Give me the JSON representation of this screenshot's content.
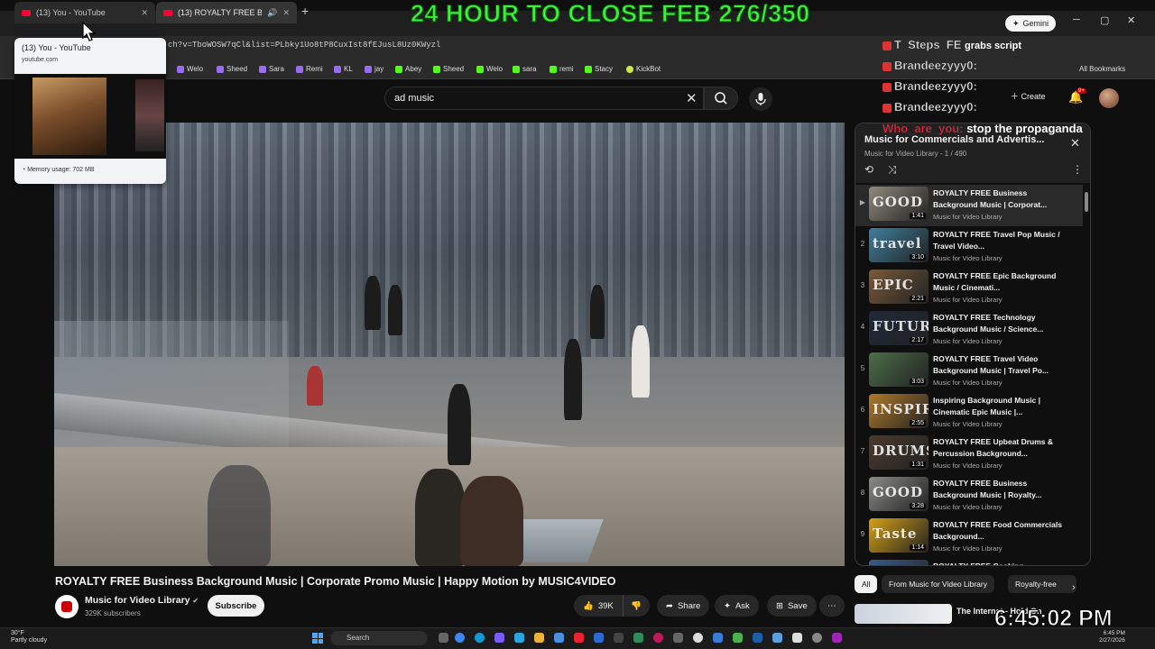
{
  "overlay": {
    "title": "24 HOUR TO CLOSE FEB 276/350",
    "clock": "6:45:02 PM",
    "chat": [
      {
        "user": "T_Steps_FE",
        "message": "grabs script"
      },
      {
        "user": "Brandeezyyy0:",
        "message": ""
      },
      {
        "user": "Brandeezyyy0:",
        "message": ""
      },
      {
        "user": "Brandeezyyy0:",
        "message": ""
      },
      {
        "user": "Who_are_you:",
        "message": "stop the propaganda"
      }
    ]
  },
  "browser": {
    "tabs": [
      {
        "title": "(13) You - YouTube"
      },
      {
        "title": "(13) ROYALTY FREE Business"
      }
    ],
    "new_tab": "+",
    "gemini_label": "Gemini",
    "url": "ch?v=TboWOSW7qCl&list=PLbky1Uo8tP8CuxIst8fEJusL8Uz0KWyzl",
    "bookmarks": [
      "Welo",
      "Sheed",
      "Sara",
      "Remi",
      "KL",
      "jay",
      "Abey",
      "Sheed",
      "Welo",
      "sara",
      "remi",
      "Stacy",
      "KickBot"
    ],
    "all_bookmarks": "All Bookmarks",
    "hover_card": {
      "title": "(13) You - YouTube",
      "domain": "youtube.com",
      "memory": "Memory usage: 702 MB"
    }
  },
  "youtube": {
    "search_value": "ad music",
    "create_label": "Create",
    "notif_count": "9+",
    "video": {
      "title": "ROYALTY FREE Business Background Music | Corporate Promo Music | Happy Motion by MUSIC4VIDEO",
      "channel": "Music for Video Library",
      "subscribers": "329K subscribers",
      "subscribe_label": "Subscribe",
      "likes": "39K",
      "share_label": "Share",
      "ask_label": "Ask",
      "save_label": "Save"
    },
    "playlist": {
      "title": "Music for Commercials and Advertis...",
      "subtitle": "Music for Video Library - 1 / 490",
      "items": [
        {
          "index": "",
          "thumb_word": "GOOD",
          "duration": "1:41",
          "title": "ROYALTY FREE Business Background Music | Corporat...",
          "channel": "Music for Video Library",
          "color": "#8f8a7c"
        },
        {
          "index": "2",
          "thumb_word": "travel",
          "duration": "3:10",
          "title": "ROYALTY FREE Travel Pop Music / Travel Video...",
          "channel": "Music for Video Library",
          "color": "#3f7f9c"
        },
        {
          "index": "3",
          "thumb_word": "EPIC",
          "duration": "2:21",
          "title": "ROYALTY FREE Epic Background Music / Cinemati...",
          "channel": "Music for Video Library",
          "color": "#7a5a3a"
        },
        {
          "index": "4",
          "thumb_word": "FUTURE",
          "duration": "2:17",
          "title": "ROYALTY FREE Technology Background Music / Science...",
          "channel": "Music for Video Library",
          "color": "#1e2a3a"
        },
        {
          "index": "5",
          "thumb_word": "",
          "duration": "3:03",
          "title": "ROYALTY FREE Travel Video Background Music | Travel Po...",
          "channel": "Music for Video Library",
          "color": "#4d6e4a"
        },
        {
          "index": "6",
          "thumb_word": "INSPIR",
          "duration": "2:55",
          "title": "Inspiring Background Music | Cinematic Epic Music |...",
          "channel": "Music for Video Library",
          "color": "#b07a2a"
        },
        {
          "index": "7",
          "thumb_word": "DRUMS",
          "duration": "1:31",
          "title": "ROYALTY FREE Upbeat Drums & Percussion Background...",
          "channel": "Music for Video Library",
          "color": "#4a3a2e"
        },
        {
          "index": "8",
          "thumb_word": "GOOD",
          "duration": "3:28",
          "title": "ROYALTY FREE Business Background Music | Royalty...",
          "channel": "Music for Video Library",
          "color": "#8a8a88"
        },
        {
          "index": "9",
          "thumb_word": "Taste",
          "duration": "1:14",
          "title": "ROYALTY FREE Food Commercials Background...",
          "channel": "Music for Video Library",
          "color": "#d4a017"
        },
        {
          "index": "",
          "thumb_word": "",
          "duration": "",
          "title": "ROYALTY FREE Cooking",
          "channel": "",
          "color": "#3a5a8a"
        }
      ]
    },
    "chips": [
      "All",
      "From Music for Video Library",
      "Royalty-free"
    ],
    "next_title": "The Internet - Hold On"
  },
  "taskbar": {
    "temperature": "30°F",
    "weather": "Partly cloudy",
    "search_placeholder": "Search",
    "time": "6:45 PM",
    "date": "2/27/2026"
  }
}
